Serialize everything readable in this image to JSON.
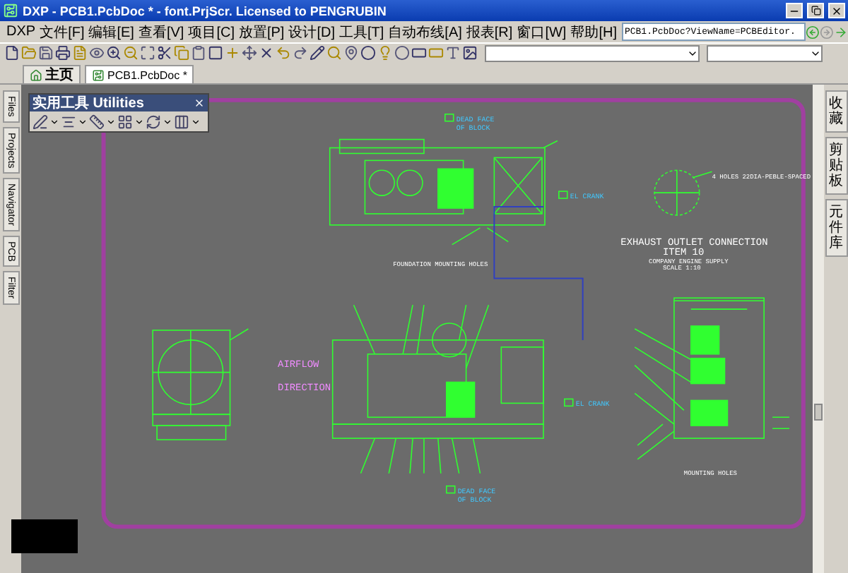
{
  "window": {
    "title": "DXP - PCB1.PcbDoc * - font.PrjScr. Licensed to PENGRUBIN"
  },
  "menu": [
    "DXP",
    "文件[F]",
    "编辑[E]",
    "查看[V]",
    "项目[C]",
    "放置[P]",
    "设计[D]",
    "工具[T]",
    "自动布线[A]",
    "报表[R]",
    "窗口[W]",
    "帮助[H]"
  ],
  "address": {
    "value": "PCB1.PcbDoc?ViewName=PCBEditor."
  },
  "document_tabs": [
    {
      "label": "主页",
      "selected": false
    },
    {
      "label": "PCB1.PcbDoc *",
      "selected": true
    }
  ],
  "left_panels": [
    "Files",
    "Projects",
    "Navigator",
    "PCB",
    "Filter"
  ],
  "right_panels": [
    "收藏",
    "剪贴板",
    "元件库"
  ],
  "utilities_toolbar": {
    "title": "实用工具 Utilities"
  },
  "drawing_labels": [
    {
      "kind": "note",
      "text": "DEAD FACE"
    },
    {
      "kind": "note",
      "text": "OF BLOCK"
    },
    {
      "kind": "note",
      "text": "EL CRANK"
    },
    {
      "kind": "caption",
      "text": "FOUNDATION MOUNTING HOLES"
    },
    {
      "kind": "caption",
      "text": "4 HOLES 22DIA-PEBLE-SPACED"
    },
    {
      "kind": "title",
      "text": "EXHAUST OUTLET CONNECTION"
    },
    {
      "kind": "title",
      "text": "ITEM 10"
    },
    {
      "kind": "caption",
      "text": "COMPANY ENGINE SUPPLY"
    },
    {
      "kind": "caption",
      "text": "SCALE 1:10"
    },
    {
      "kind": "direction",
      "text": "AIRFLOW"
    },
    {
      "kind": "direction",
      "text": "DIRECTION"
    },
    {
      "kind": "note",
      "text": "EL CRANK"
    },
    {
      "kind": "note",
      "text": "DEAD FACE"
    },
    {
      "kind": "note",
      "text": "OF BLOCK"
    },
    {
      "kind": "caption",
      "text": "MOUNTING HOLES"
    }
  ]
}
